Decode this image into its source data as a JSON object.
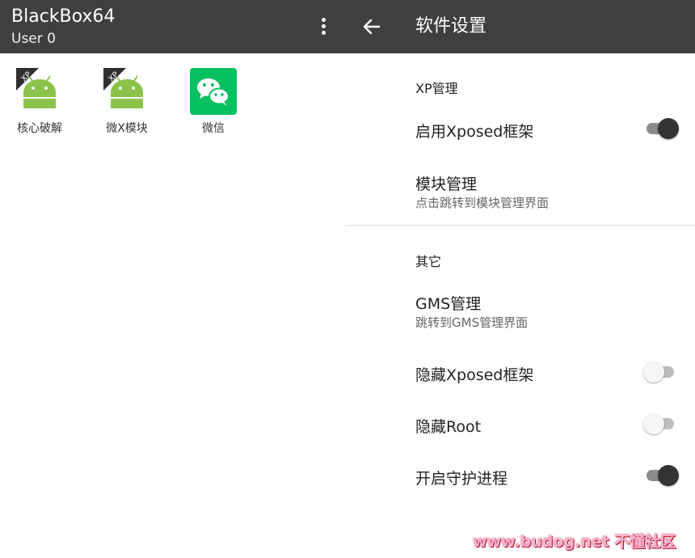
{
  "left_panel": {
    "appbar": {
      "title": "BlackBox64",
      "subtitle": "User 0",
      "menu_icon": "more-vert-icon"
    },
    "apps": [
      {
        "label": "核心破解",
        "icon": "android-xp-icon",
        "badge": "XP"
      },
      {
        "label": "微X模块",
        "icon": "android-xp-icon",
        "badge": "XP"
      },
      {
        "label": "微信",
        "icon": "wechat-icon"
      }
    ],
    "colors": {
      "appbar": "#3f3f3f",
      "android_green": "#8bc34a",
      "wechat_green": "#07c160"
    }
  },
  "right_panel": {
    "appbar": {
      "title": "软件设置",
      "back_icon": "arrow-back-icon"
    },
    "sections": [
      {
        "title": "XP管理",
        "items": [
          {
            "title": "启用Xposed框架",
            "switch": true
          },
          {
            "title": "模块管理",
            "summary": "点击跳转到模块管理界面"
          }
        ]
      },
      {
        "title": "其它",
        "items": [
          {
            "title": "GMS管理",
            "summary": "跳转到GMS管理界面"
          },
          {
            "title": "隐藏Xposed框架",
            "switch": false
          },
          {
            "title": "隐藏Root",
            "switch": false
          },
          {
            "title": "开启守护进程",
            "switch": true
          }
        ]
      }
    ]
  },
  "watermark": "www.budog.net 不懂社区"
}
